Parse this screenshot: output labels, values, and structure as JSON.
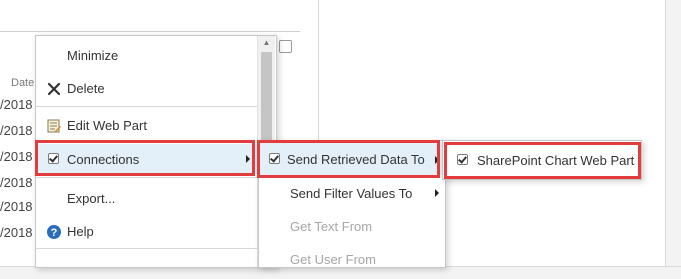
{
  "background_panel": {
    "column_header": "Date",
    "date_cells": [
      "/2018",
      "/2018",
      "/2018",
      "/2018",
      "/2018",
      "/2018"
    ]
  },
  "webpart_menu": {
    "items": [
      {
        "label": "Minimize",
        "icon": "none"
      },
      {
        "label": "Delete",
        "icon": "close-icon"
      },
      {
        "label": "Edit Web Part",
        "icon": "edit-icon"
      },
      {
        "label": "Connections",
        "icon": "checkbox-icon",
        "has_submenu": true,
        "highlighted": true
      },
      {
        "label": "Export...",
        "icon": "none"
      },
      {
        "label": "Help",
        "icon": "help-icon"
      }
    ]
  },
  "connections_submenu": {
    "items": [
      {
        "label": "Send Retrieved Data To",
        "icon": "checkbox-icon",
        "has_submenu": true,
        "highlighted": true
      },
      {
        "label": "Send Filter Values To",
        "has_submenu": true,
        "disabled": false
      },
      {
        "label": "Get Text From",
        "disabled": true
      },
      {
        "label": "Get User From",
        "disabled": true
      }
    ]
  },
  "send_data_submenu": {
    "items": [
      {
        "label": "SharePoint Chart Web Part",
        "icon": "checkbox-icon"
      }
    ]
  },
  "colors": {
    "highlight_background": "#e3f0f9",
    "callout_border": "#e23c3c",
    "help_icon": "#2a6ebb",
    "delete_icon": "#333333",
    "disabled_text": "#a6a6a6"
  }
}
